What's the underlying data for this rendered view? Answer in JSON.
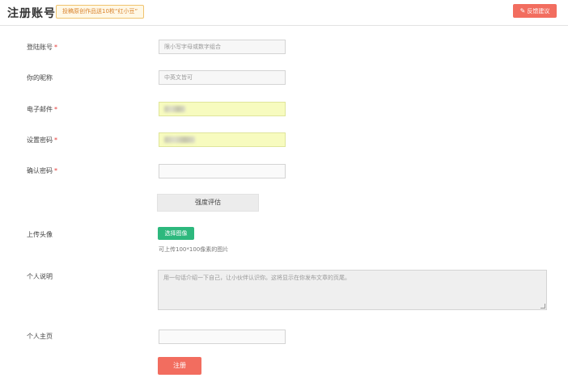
{
  "header": {
    "title": "注册账号",
    "promo": "投稿原创作品送10枚“红小豆”",
    "feedback_label": "反馈建议"
  },
  "form": {
    "login_account": {
      "label": "登陆账号",
      "required_mark": "*",
      "placeholder": "限小写字母或数字组合"
    },
    "nickname": {
      "label": "你的昵称",
      "placeholder": "中英文皆可"
    },
    "email": {
      "label": "电子邮件",
      "required_mark": "*",
      "value": ""
    },
    "password": {
      "label": "设置密码",
      "required_mark": "*",
      "value": ""
    },
    "confirm_password": {
      "label": "确认密码",
      "required_mark": "*",
      "value": ""
    },
    "strength_button": "强度评估",
    "avatar": {
      "label": "上传头像",
      "button": "选择图像",
      "hint": "可上传100*100像素的图片"
    },
    "bio": {
      "label": "个人说明",
      "placeholder": "用一句话介绍一下自己，让小伙伴认识你。这将显示在你发布文章的页尾。"
    },
    "homepage": {
      "label": "个人主页",
      "value": ""
    },
    "submit_button": "注册"
  },
  "colors": {
    "accent_red": "#f26d5f",
    "accent_green": "#2db87d",
    "autofill_yellow": "#f7fbbf",
    "required_red": "#e53935"
  }
}
